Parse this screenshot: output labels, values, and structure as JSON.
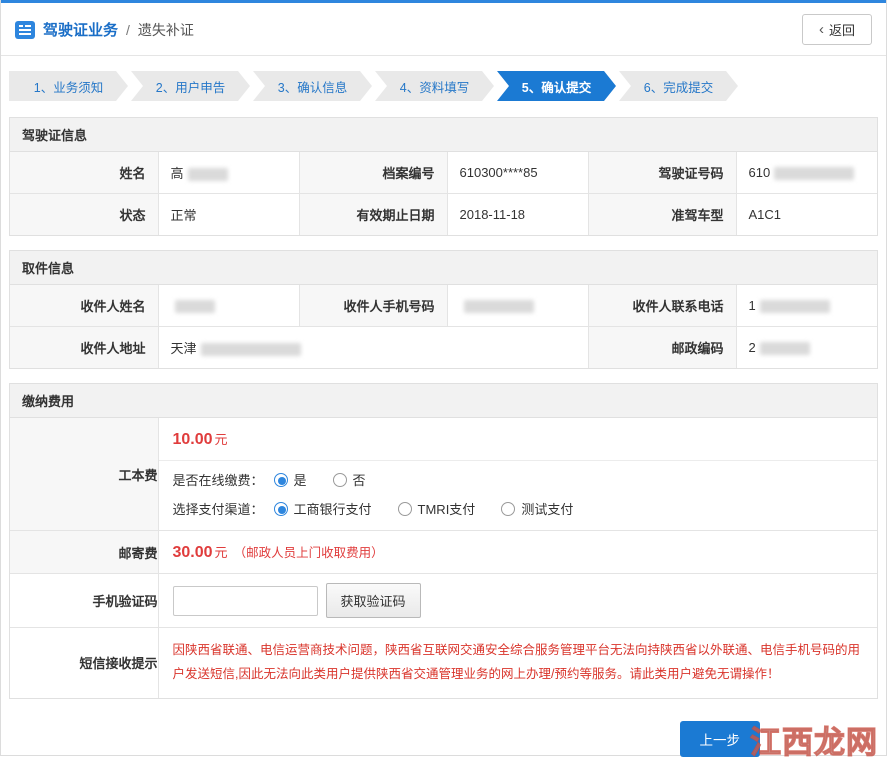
{
  "page": {
    "title_primary": "驾驶证业务",
    "title_separator": "/",
    "title_secondary": "遗失补证",
    "back_label": "返回"
  },
  "steps": [
    {
      "label": "1、业务须知"
    },
    {
      "label": "2、用户申告"
    },
    {
      "label": "3、确认信息"
    },
    {
      "label": "4、资料填写"
    },
    {
      "label": "5、确认提交"
    },
    {
      "label": "6、完成提交"
    }
  ],
  "license": {
    "title": "驾驶证信息",
    "name_label": "姓名",
    "name_value": "高",
    "file_label": "档案编号",
    "file_value": "610300****85",
    "licno_label": "驾驶证号码",
    "licno_value": "610",
    "status_label": "状态",
    "status_value": "正常",
    "expiry_label": "有效期止日期",
    "expiry_value": "2018-11-18",
    "vehicle_label": "准驾车型",
    "vehicle_value": "A1C1"
  },
  "pickup": {
    "title": "取件信息",
    "recv_name_label": "收件人姓名",
    "recv_name_value": "",
    "recv_mobile_label": "收件人手机号码",
    "recv_mobile_value": "",
    "recv_phone_label": "收件人联系电话",
    "recv_phone_value": "1",
    "recv_addr_label": "收件人地址",
    "recv_addr_value": "天津",
    "postal_label": "邮政编码",
    "postal_value": "2"
  },
  "fees": {
    "title": "缴纳费用",
    "production": {
      "label": "工本费",
      "amount": "10.00",
      "unit": "元",
      "online_question": "是否在线缴费：",
      "yes": "是",
      "no": "否",
      "channel_question": "选择支付渠道：",
      "channel1": "工商银行支付",
      "channel2": "TMRI支付",
      "channel3": "测试支付"
    },
    "postage": {
      "label": "邮寄费",
      "amount": "30.00",
      "unit": "元",
      "note": "（邮政人员上门收取费用）"
    },
    "captcha": {
      "label": "手机验证码",
      "input_value": "",
      "button_label": "获取验证码"
    },
    "sms": {
      "label": "短信接收提示",
      "text": "因陕西省联通、电信运营商技术问题，陕西省互联网交通安全综合服务管理平台无法向持陕西省以外联通、电信手机号码的用户发送短信,因此无法向此类用户提供陕西省交通管理业务的网上办理/预约等服务。请此类用户避免无谓操作！"
    }
  },
  "footer": {
    "prev_label": "上一步",
    "watermark": "江西龙网"
  },
  "colors": {
    "accent_blue": "#1b7ad3",
    "step_text_blue": "#2577c8",
    "danger_red": "#e03c3c"
  }
}
